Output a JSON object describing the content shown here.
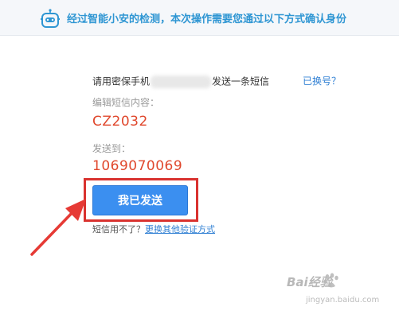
{
  "header": {
    "icon": "robot-assistant-icon",
    "title": "经过智能小安的检测，本次操作需要您通过以下方式确认身份",
    "background_color": "#f5f7fa",
    "title_color": "#2f96d3"
  },
  "sms_instruction": {
    "prefix": "请用密保手机",
    "suffix": "发送一条短信",
    "change_phone_link": "已换号？"
  },
  "content": {
    "label": "编辑短信内容：",
    "code": "CZ2032"
  },
  "send_to": {
    "label": "发送到：",
    "number": "1069070069"
  },
  "send_button": {
    "label": "我已发送",
    "color": "#3b8ff0"
  },
  "footer": {
    "prompt": "短信用不了？",
    "alt_link": "更换其他验证方式"
  },
  "annotation": {
    "box_color": "#d9322f",
    "arrow_color": "#e63a35"
  },
  "watermark": {
    "text": "Bai经验",
    "sub": "jingyan.baidu.com"
  }
}
